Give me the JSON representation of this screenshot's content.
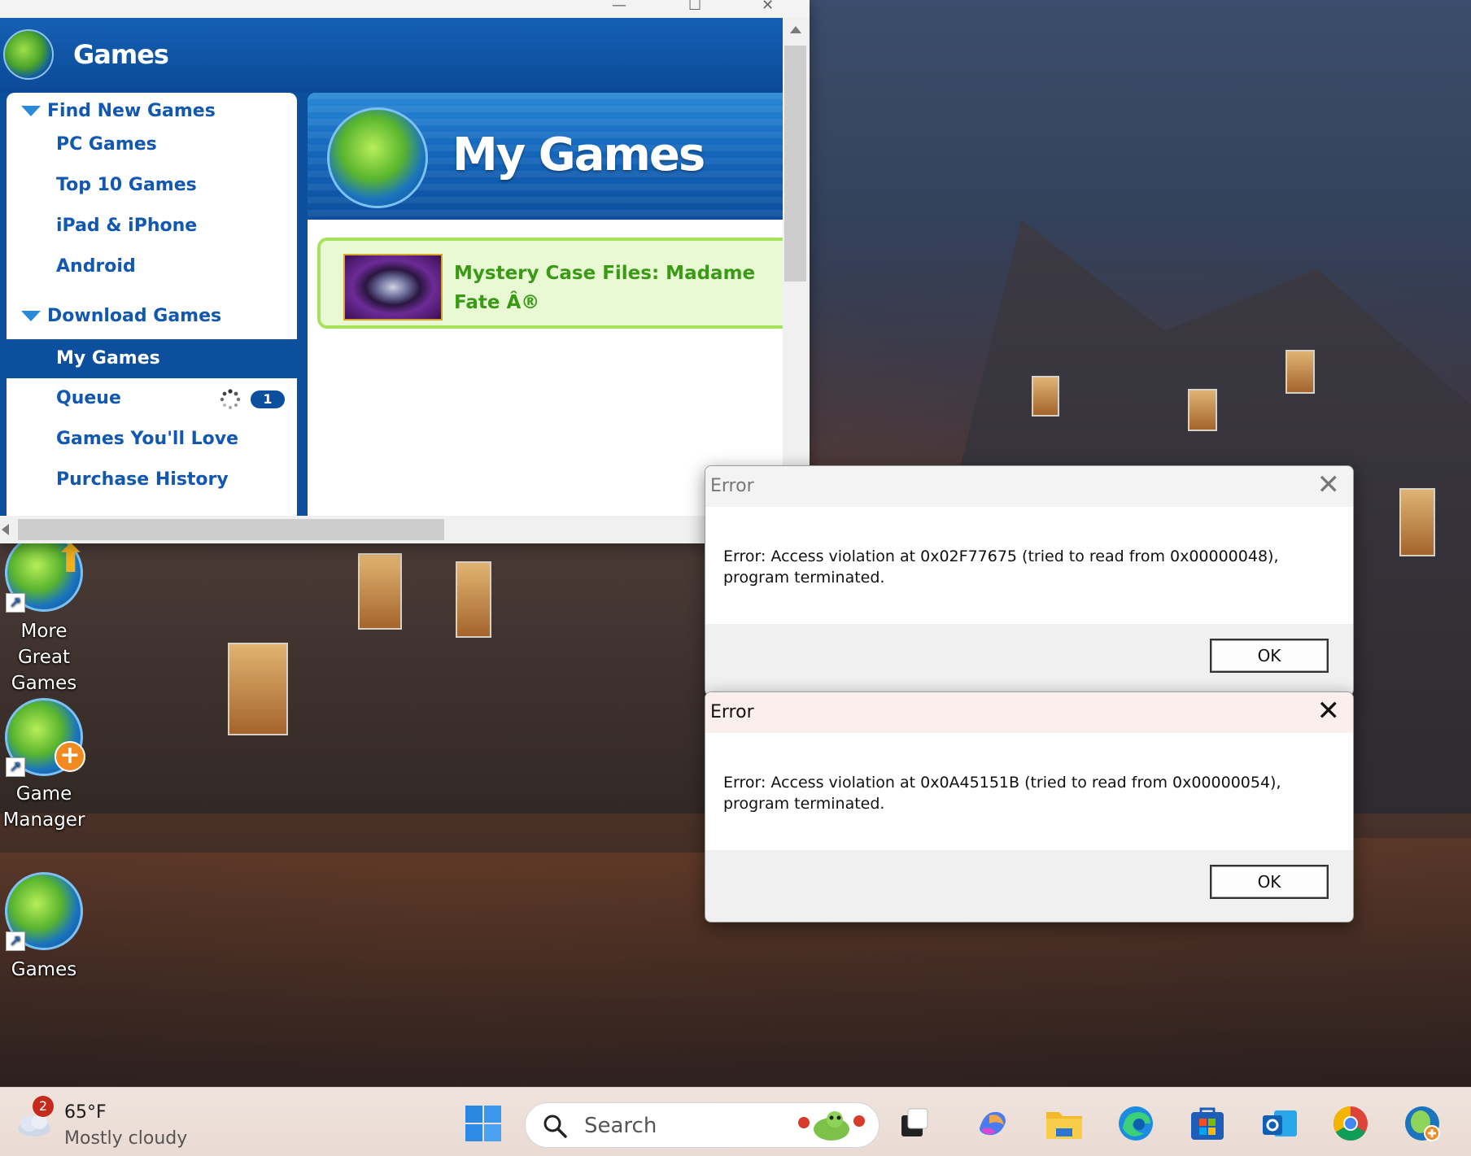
{
  "game_manager": {
    "app_title": "Games",
    "sidebar": {
      "section_find": "Find New Games",
      "find_items": [
        "PC Games",
        "Top 10 Games",
        "iPad & iPhone",
        "Android"
      ],
      "section_download": "Download Games",
      "download_items": [
        "My Games",
        "Queue",
        "Games You'll Love",
        "Purchase History"
      ],
      "queue_count": "1"
    },
    "banner_title": "My Games",
    "game_title": "Mystery Case Files: Madame Fate Â®"
  },
  "desktop_icons": [
    {
      "label": "More Great Games"
    },
    {
      "label": "Game Manager"
    },
    {
      "label": "Games"
    }
  ],
  "dialogs": [
    {
      "title": "Error",
      "message": "Error: Access violation at 0x02F77675 (tried to read from 0x00000048), program terminated.",
      "ok": "OK"
    },
    {
      "title": "Error",
      "message": "Error: Access violation at 0x0A45151B (tried to read from 0x00000054), program terminated.",
      "ok": "OK"
    }
  ],
  "taskbar": {
    "weather_badge": "2",
    "temperature": "65°F",
    "condition": "Mostly cloudy",
    "search_label": "Search"
  }
}
